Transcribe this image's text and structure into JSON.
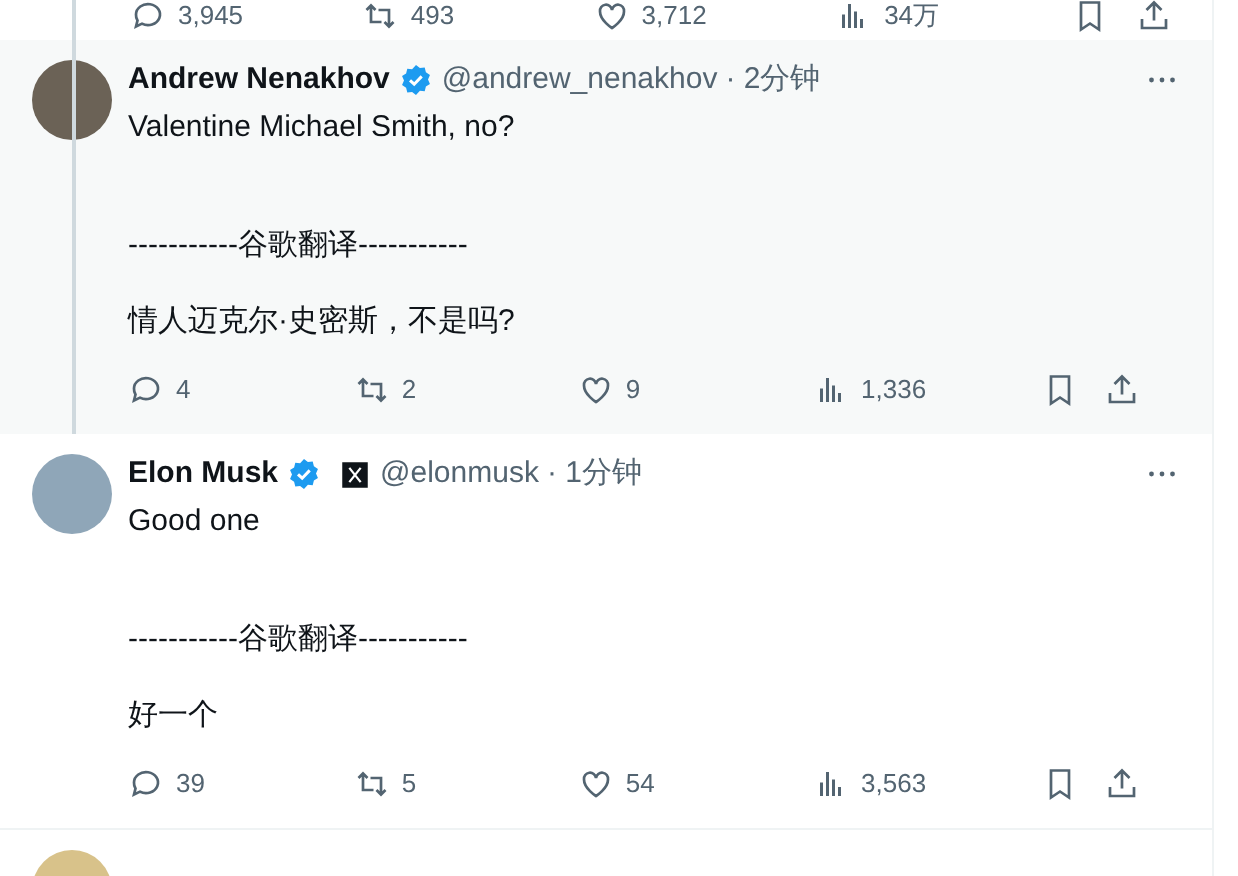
{
  "top_actions": [
    {
      "kind": "reply",
      "count": "3,945"
    },
    {
      "kind": "retweet",
      "count": "493"
    },
    {
      "kind": "like",
      "count": "3,712"
    },
    {
      "kind": "views",
      "count": "34万"
    },
    {
      "kind": "bookmark"
    },
    {
      "kind": "share"
    }
  ],
  "replies": [
    {
      "name": "Andrew Nenakhov",
      "verified": true,
      "affiliate": false,
      "handle": "@andrew_nenakhov",
      "time": "· 2分钟",
      "highlighted": true,
      "thread_line": true,
      "paragraphs": [
        "Valentine Michael Smith, no?",
        "-----------谷歌翻译-----------",
        "情人迈克尔·史密斯，不是吗?"
      ],
      "actions": [
        {
          "kind": "reply",
          "count": "4"
        },
        {
          "kind": "retweet",
          "count": "2"
        },
        {
          "kind": "like",
          "count": "9"
        },
        {
          "kind": "views",
          "count": "1,336"
        },
        {
          "kind": "bookmark"
        },
        {
          "kind": "share"
        }
      ]
    },
    {
      "name": "Elon Musk",
      "verified": true,
      "affiliate": true,
      "handle": "@elonmusk",
      "time": "· 1分钟",
      "highlighted": false,
      "thread_line": false,
      "paragraphs": [
        "Good one",
        "-----------谷歌翻译-----------",
        "好一个"
      ],
      "actions": [
        {
          "kind": "reply",
          "count": "39"
        },
        {
          "kind": "retweet",
          "count": "5"
        },
        {
          "kind": "like",
          "count": "54"
        },
        {
          "kind": "views",
          "count": "3,563"
        },
        {
          "kind": "bookmark"
        },
        {
          "kind": "share"
        }
      ]
    }
  ]
}
